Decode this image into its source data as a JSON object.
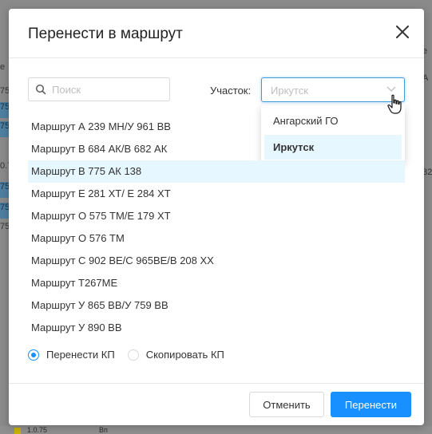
{
  "dialog": {
    "title": "Перенести в маршрут",
    "search_placeholder": "Поиск",
    "area_label": "Участок:",
    "area_select_placeholder": "Иркутск",
    "area_options": [
      "Ангарский ГО",
      "Иркутск"
    ],
    "area_selected_option": "Иркутск",
    "routes": [
      "Маршрут А 239 МН/У 961 ВВ",
      "Маршрут В 684 АК/В 682 АК",
      "Маршрут В 775 АК 138",
      "Маршрут Е 281 ХТ/ Е 284 ХТ",
      "Маршрут О 575 ТМ/Е 179 ХТ",
      "Маршрут О 576 ТМ",
      "Маршрут С 902 ВЕ/С 965ВЕ/В 208 ХХ",
      "Маршрут Т267МЕ",
      "Маршрут У 865 ВВ/У 759 ВВ",
      "Маршрут У 890 ВВ"
    ],
    "highlighted_route": "Маршрут В 775 АК 138",
    "radio_options": [
      "Перенести КП",
      "Скопировать КП"
    ],
    "radio_selected": "Перенести КП",
    "cancel_label": "Отменить",
    "confirm_label": "Перенести"
  },
  "background": {
    "left_cells": [
      "е",
      "75",
      "75",
      "75",
      "0.7",
      "75",
      "75",
      "75"
    ],
    "right_cells": [
      "е",
      "А",
      "32"
    ],
    "bottom_texts": [
      "1.0.75",
      "Вп"
    ]
  },
  "colors": {
    "accent": "#1890ff",
    "selected_bg": "#e6f7ff",
    "overlay": "#8a8a8a"
  },
  "icons": {
    "close": "close-icon",
    "search": "search-icon",
    "chevron": "chevron-down-icon",
    "cursor": "hand-pointer-icon"
  }
}
